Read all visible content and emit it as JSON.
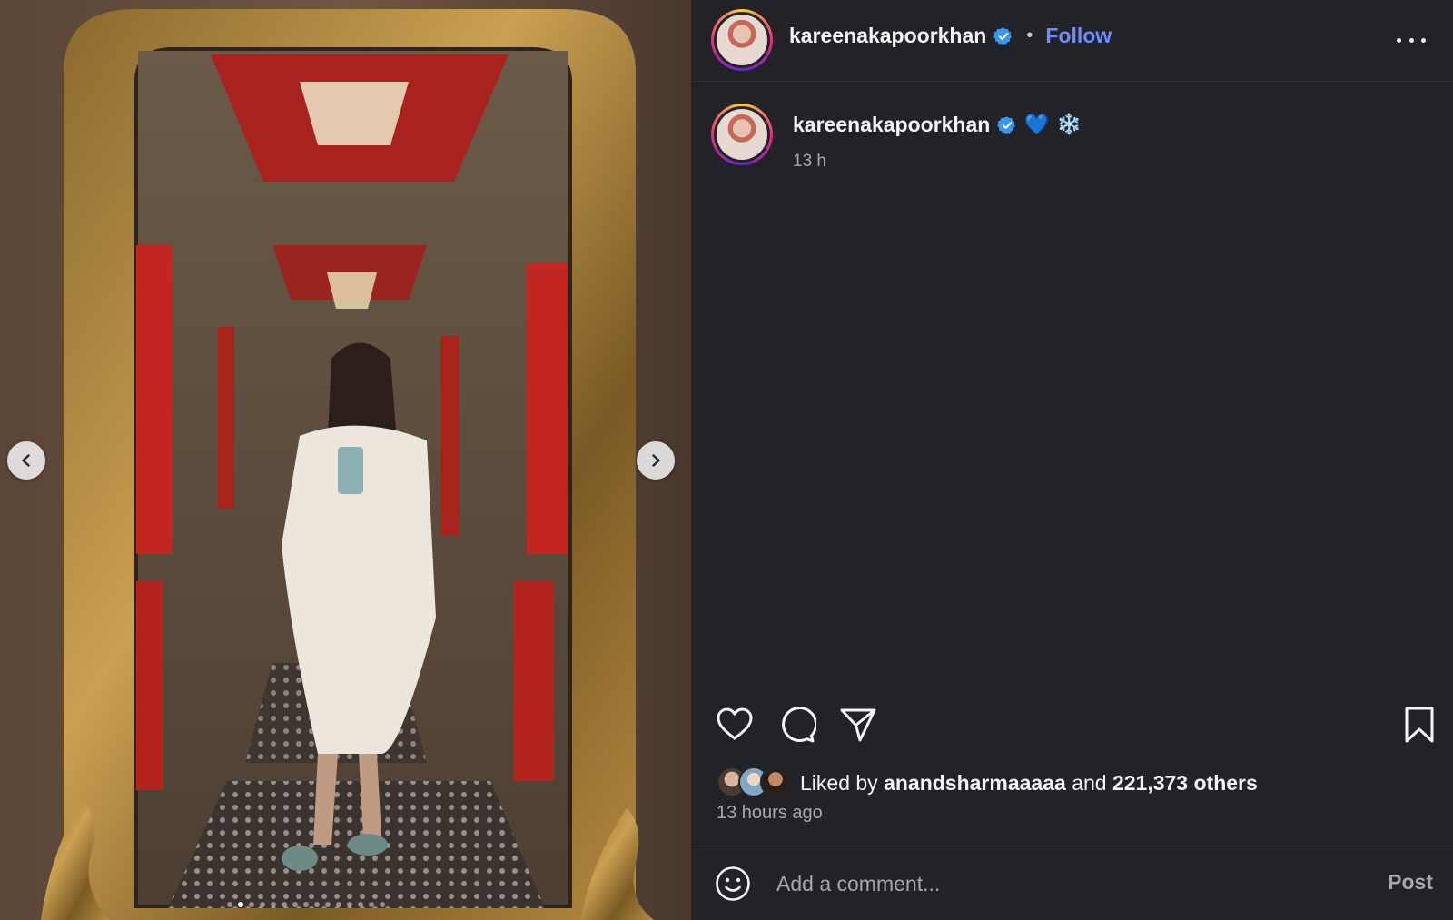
{
  "post": {
    "username": "kareenakapoorkhan",
    "verified": true,
    "separator": "•",
    "follow_label": "Follow",
    "more_icon": "more-horizontal-icon"
  },
  "caption": {
    "username": "kareenakapoorkhan",
    "emoji_heart": "💙",
    "emoji_snow": "❄️",
    "time": "13 h"
  },
  "carousel": {
    "slide_count": 15,
    "active_index": 1,
    "prev_icon": "chevron-left-icon",
    "next_icon": "chevron-right-icon"
  },
  "actions": {
    "like_icon": "heart-icon",
    "comment_icon": "comment-bubble-icon",
    "share_icon": "paper-plane-icon",
    "save_icon": "bookmark-icon"
  },
  "likes": {
    "prefix": "Liked by",
    "user": "anandsharmaaaaa",
    "and": "and",
    "count": "221,373 others"
  },
  "timestamp": "13 hours ago",
  "comment": {
    "placeholder": "Add a comment...",
    "post_label": "Post",
    "emoji_icon": "smiley-icon"
  },
  "colors": {
    "background": "#212328",
    "accent": "#6f8cff",
    "verified": "#3897f0",
    "muted": "#a8a8a8"
  }
}
